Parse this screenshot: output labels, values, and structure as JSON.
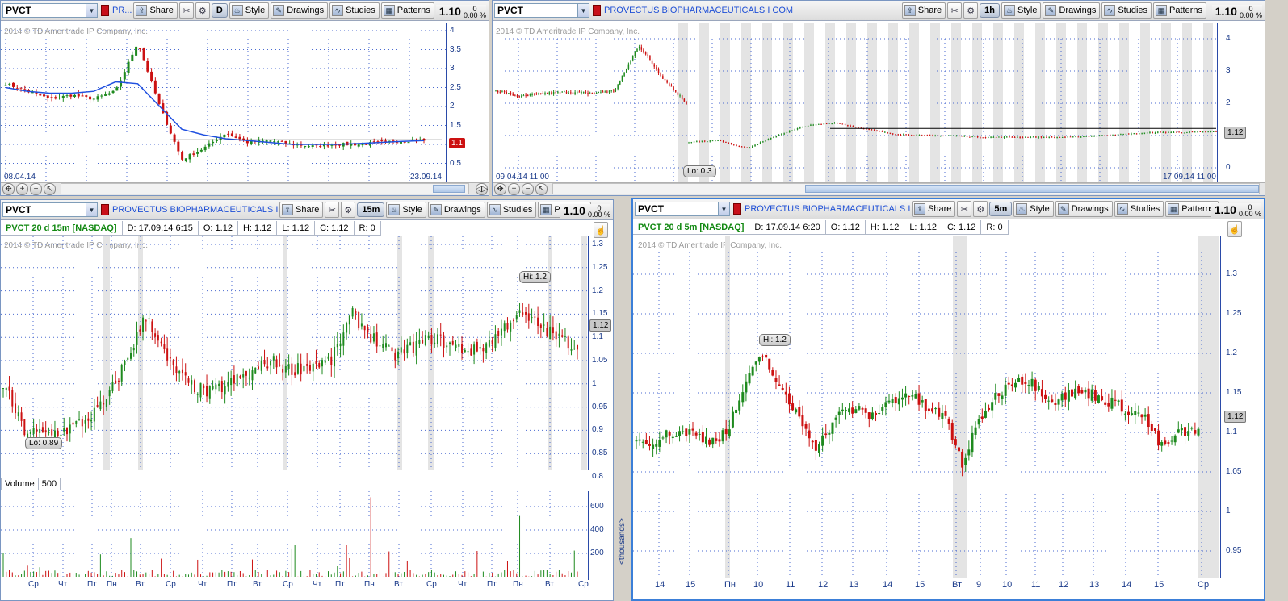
{
  "symbol": "PVCT",
  "company_full": "PROVECTUS BIOPHARMACEUTICALS I COM",
  "company_short1": "PR...",
  "company_short2": "PROVECTUS BIOPHARMACEUTICALS I C...",
  "last_price": "1.10",
  "change_pct": "0",
  "change_pct2": "0.00 %",
  "copyright_full": "2014 © TD Ameritrade IP Company, Inc.",
  "copyright_short": "2014 © TD Ameritrade IP Company, Inc.",
  "toolbar": {
    "share": "Share",
    "style": "Style",
    "drawings": "Drawings",
    "studies": "Studies",
    "patterns": "Patterns"
  },
  "colors": {
    "up": "#1e8a1e",
    "down": "#cc1111",
    "accent": "#1e4fd6",
    "ma": "#2050e0"
  },
  "panels": {
    "daily": {
      "aggregation": "D",
      "yticks": [
        "4",
        "3.5",
        "3",
        "2.5",
        "2",
        "1.5",
        "1",
        "0.5"
      ],
      "price_tag": "1.1",
      "start_date": "08.04.14",
      "end_date": "23.09.14"
    },
    "hourly": {
      "aggregation": "1h",
      "yticks": [
        "4",
        "3",
        "2",
        "1",
        "0"
      ],
      "price_tag": "1.12",
      "lo_label": "Lo: 0.3",
      "start_date": "09.04.14 11:00",
      "end_date": "17.09.14 11:00"
    },
    "m15": {
      "aggregation": "15m",
      "info": {
        "study": "PVCT 20 d 15m [NASDAQ]",
        "d": "D: 17.09.14 6:15",
        "o": "O: 1.12",
        "h": "H: 1.12",
        "l": "L: 1.12",
        "c": "C: 1.12",
        "r": "R: 0"
      },
      "yticks": [
        "1.3",
        "1.25",
        "1.2",
        "1.15",
        "1.1",
        "1.05",
        "1",
        "0.95",
        "0.9",
        "0.85",
        "0.8"
      ],
      "price_tag": "1.12",
      "hi_label": "Hi: 1.2",
      "lo_label": "Lo: 0.89",
      "volume_label": "Volume",
      "volume_value": "500",
      "vol_ticks": [
        "600",
        "400",
        "200"
      ],
      "xticks": [
        "Ср",
        "Чт",
        "Пт",
        "Пн",
        "Вт",
        "Ср",
        "Чт",
        "Пт",
        "Вт",
        "Ср",
        "Чт",
        "Пт",
        "Пн",
        "Вт",
        "Ср",
        "Чт",
        "Пт",
        "Пн",
        "Вт",
        "Ср"
      ]
    },
    "m5": {
      "aggregation": "5m",
      "info": {
        "study": "PVCT 20 d 5m [NASDAQ]",
        "d": "D: 17.09.14 6:20",
        "o": "O: 1.12",
        "h": "H: 1.12",
        "l": "L: 1.12",
        "c": "C: 1.12",
        "r": "R: 0"
      },
      "yticks": [
        "1.3",
        "1.25",
        "1.2",
        "1.15",
        "1.1",
        "1.05",
        "1",
        "0.95"
      ],
      "price_tag": "1.12",
      "hi_label": "Hi: 1.2",
      "side_label": "<thousands>",
      "xticks": [
        "14",
        "15",
        "Пн",
        "10",
        "11",
        "12",
        "13",
        "14",
        "15",
        "Вт",
        "9",
        "10",
        "11",
        "12",
        "13",
        "14",
        "15",
        "Ср"
      ]
    }
  }
}
